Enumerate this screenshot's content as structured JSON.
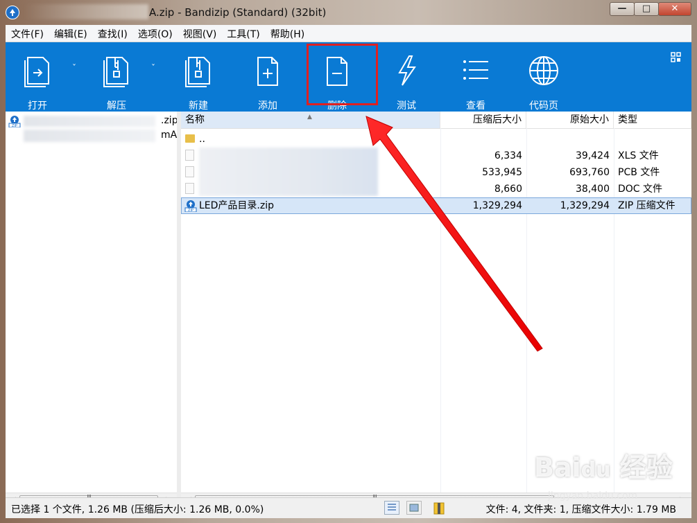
{
  "window": {
    "title": "A.zip - Bandizip (Standard) (32bit)",
    "buttons": {
      "minimize": "—",
      "maximize": "□",
      "close": "✕"
    }
  },
  "menu": [
    "文件(F)",
    "编辑(E)",
    "查找(I)",
    "选项(O)",
    "视图(V)",
    "工具(T)",
    "帮助(H)"
  ],
  "toolbar": {
    "open": "打开",
    "extract": "解压",
    "new": "新建",
    "add": "添加",
    "delete": "删除",
    "test": "测试",
    "view": "查看",
    "codepage": "代码页",
    "dropdown_arrow": "ˇ"
  },
  "tree": {
    "items": [
      ".zip",
      "mA"
    ]
  },
  "columns": {
    "name": "名称",
    "packed": "压缩后大小",
    "original": "原始大小",
    "type": "类型"
  },
  "files": [
    {
      "name": "..",
      "packed": "",
      "original": "",
      "type": ""
    },
    {
      "name": "",
      "packed": "6,334",
      "original": "39,424",
      "type": "XLS 文件"
    },
    {
      "name": "",
      "packed": "533,945",
      "original": "693,760",
      "type": "PCB 文件"
    },
    {
      "name": "",
      "packed": "8,660",
      "original": "38,400",
      "type": "DOC 文件"
    },
    {
      "name": "LED产品目录.zip",
      "packed": "1,329,294",
      "original": "1,329,294",
      "type": "ZIP 压缩文件"
    }
  ],
  "status": {
    "left": "已选择 1 个文件, 1.26 MB (压缩后大小: 1.26 MB, 0.0%)",
    "right": "文件: 4, 文件夹: 1, 压缩文件大小: 1.79 MB"
  },
  "scroll": {
    "thumb_grip": "III",
    "left_arrow": "◀",
    "right_arrow": "▶"
  },
  "colors": {
    "toolbar": "#0a7ad4",
    "highlight": "#e02020",
    "selection": "#d6e6f8"
  }
}
